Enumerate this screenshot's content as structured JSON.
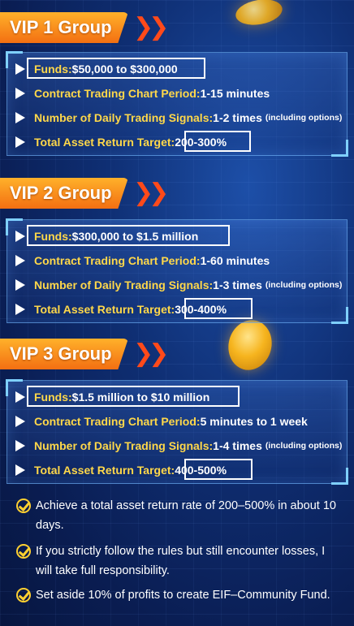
{
  "groups": [
    {
      "title": "VIP 1 Group",
      "rows": [
        {
          "label": "Funds:",
          "value": "$50,000 to $300,000",
          "note": ""
        },
        {
          "label": "Contract Trading Chart Period:",
          "value": "1-15 minutes",
          "note": ""
        },
        {
          "label": "Number of Daily Trading Signals:",
          "value": "1-2 times",
          "note": "(including options)"
        },
        {
          "label": "Total Asset Return Target:",
          "value": "200-300%",
          "note": ""
        }
      ]
    },
    {
      "title": "VIP 2 Group",
      "rows": [
        {
          "label": "Funds:",
          "value": "$300,000 to $1.5 million",
          "note": ""
        },
        {
          "label": "Contract Trading Chart Period:",
          "value": "1-60 minutes",
          "note": ""
        },
        {
          "label": "Number of Daily Trading Signals:",
          "value": "1-3 times",
          "note": "(including options)"
        },
        {
          "label": "Total Asset Return Target:",
          "value": "300-400%",
          "note": ""
        }
      ]
    },
    {
      "title": "VIP 3 Group",
      "rows": [
        {
          "label": "Funds:",
          "value": "$1.5 million to $10 million",
          "note": ""
        },
        {
          "label": "Contract Trading Chart Period:",
          "value": "5 minutes to 1 week",
          "note": ""
        },
        {
          "label": "Number of Daily Trading Signals:",
          "value": "1-4 times",
          "note": "(including options)"
        },
        {
          "label": "Total Asset Return Target:",
          "value": "400-500%",
          "note": ""
        }
      ]
    }
  ],
  "notes": [
    "Achieve a total asset return rate of 200–500% in about 10 days.",
    "If you strictly follow the rules but still encounter losses, I will take full responsibility.",
    "Set aside 10% of profits to create EIF–Community Fund."
  ],
  "colors": {
    "label": "#ffd84a",
    "header": "#f6891c",
    "chevron": "#ff4a1a",
    "check": "#ffd030"
  }
}
